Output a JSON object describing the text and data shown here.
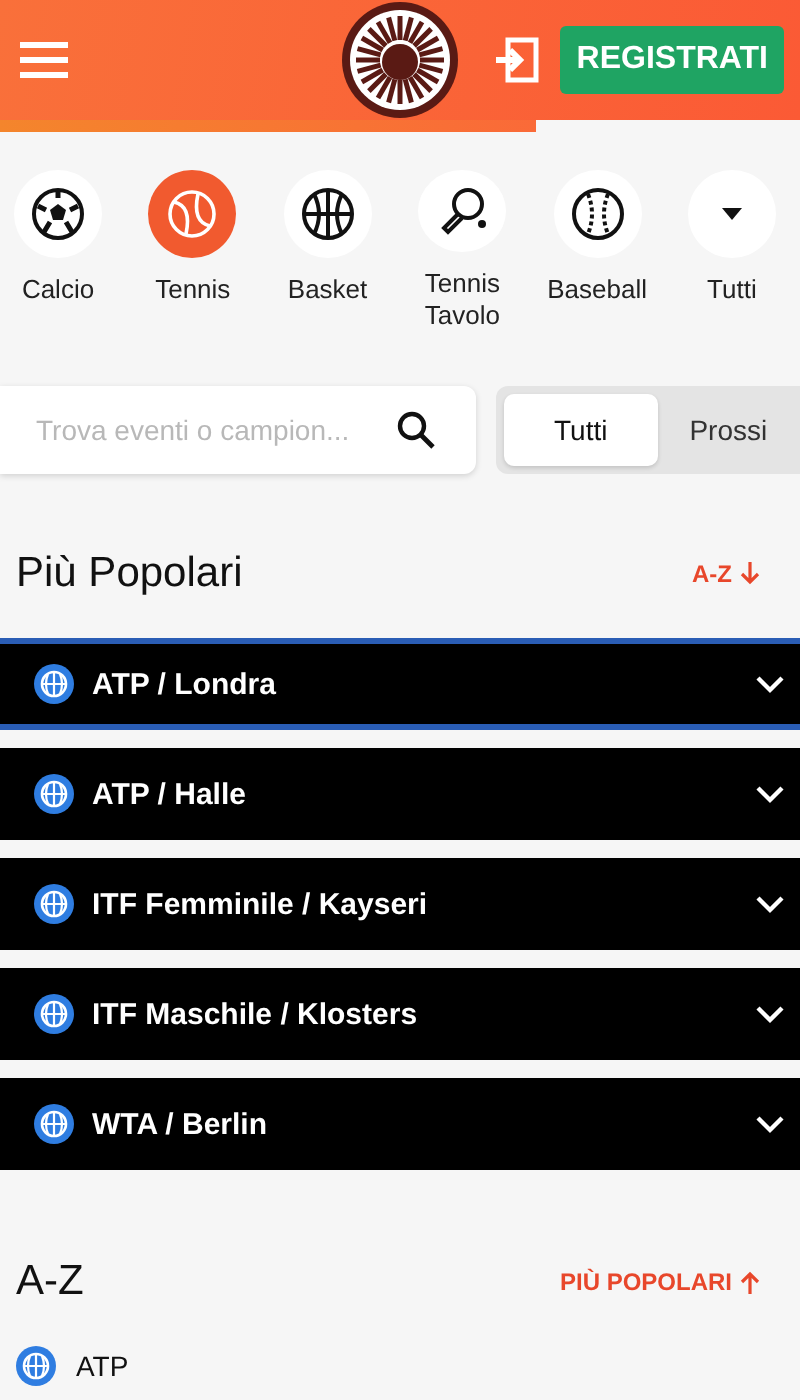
{
  "header": {
    "register_button": "REGISTRATI"
  },
  "sports": [
    {
      "label": "Calcio",
      "kind": "soccer",
      "selected": false
    },
    {
      "label": "Tennis",
      "kind": "tennis",
      "selected": true
    },
    {
      "label": "Basket",
      "kind": "basket",
      "selected": false
    },
    {
      "label": "Tennis Tavolo",
      "kind": "pingpong",
      "selected": false
    },
    {
      "label": "Baseball",
      "kind": "baseball",
      "selected": false
    },
    {
      "label": "Tutti",
      "kind": "more",
      "selected": false
    }
  ],
  "search": {
    "placeholder": "Trova eventi o campion..."
  },
  "filter_tabs": [
    {
      "label": "Tutti",
      "selected": true
    },
    {
      "label": "Prossi",
      "selected": false
    }
  ],
  "popular": {
    "title": "Più Popolari",
    "sort_link": "A-Z",
    "items": [
      {
        "label": "ATP / Londra",
        "focused": true
      },
      {
        "label": "ATP / Halle",
        "focused": false
      },
      {
        "label": "ITF Femminile / Kayseri",
        "focused": false
      },
      {
        "label": "ITF Maschile / Klosters",
        "focused": false
      },
      {
        "label": "WTA / Berlin",
        "focused": false
      }
    ]
  },
  "az": {
    "title": "A-Z",
    "sort_link": "PIÙ POPOLARI",
    "items": [
      {
        "label": "ATP"
      }
    ]
  }
}
